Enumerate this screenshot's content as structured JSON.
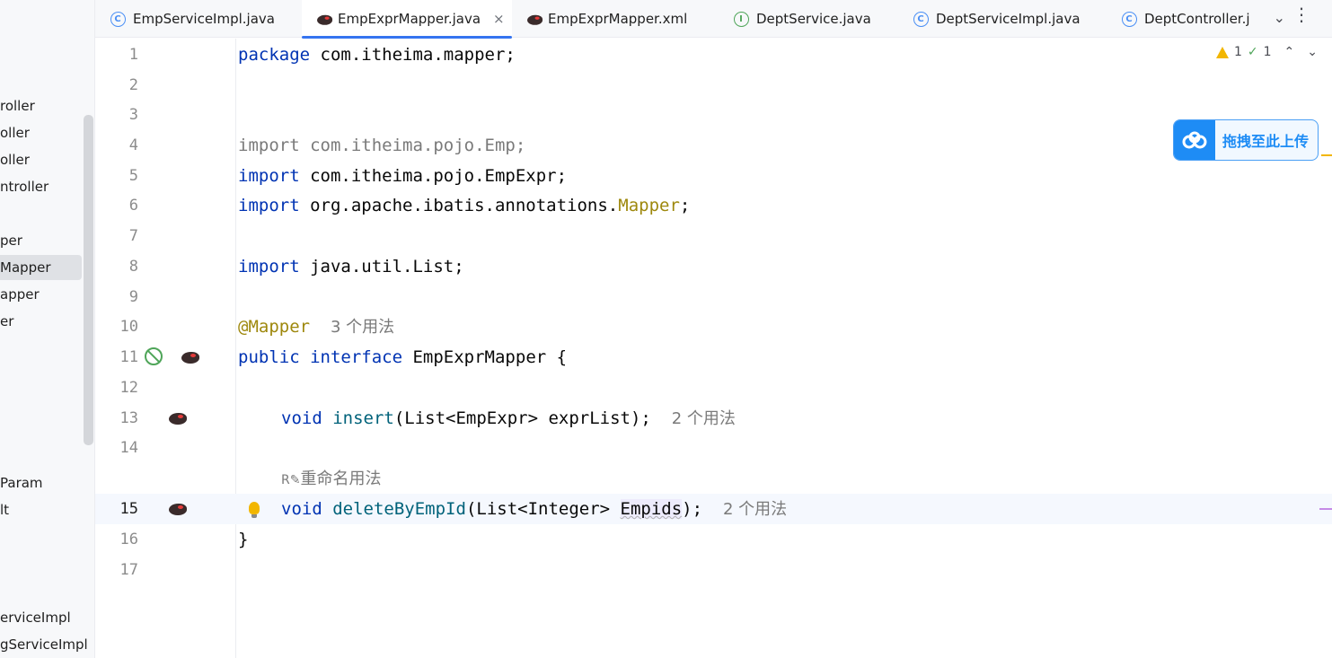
{
  "project_tree": {
    "items": [
      {
        "label": "roller",
        "selected": false
      },
      {
        "label": "oller",
        "selected": false
      },
      {
        "label": "oller",
        "selected": false
      },
      {
        "label": "ntroller",
        "selected": false
      },
      {
        "label": "per",
        "selected": false
      },
      {
        "label": "Mapper",
        "selected": true
      },
      {
        "label": "apper",
        "selected": false
      },
      {
        "label": "er",
        "selected": false
      },
      {
        "label": "Param",
        "selected": false
      },
      {
        "label": "lt",
        "selected": false
      },
      {
        "label": "erviceImpl",
        "selected": false
      },
      {
        "label": "gServiceImpl",
        "selected": false
      }
    ]
  },
  "tabs": [
    {
      "label": "EmpServiceImpl.java",
      "icon": "class-icon",
      "active": false
    },
    {
      "label": "EmpExprMapper.java",
      "icon": "mybatis-bird-icon",
      "active": true,
      "close": "×"
    },
    {
      "label": "EmpExprMapper.xml",
      "icon": "mybatis-bird-icon",
      "active": false
    },
    {
      "label": "DeptService.java",
      "icon": "interface-icon",
      "active": false
    },
    {
      "label": "DeptServiceImpl.java",
      "icon": "class-icon",
      "active": false
    },
    {
      "label": "DeptController.j",
      "icon": "class-icon",
      "active": false
    }
  ],
  "tab_bar": {
    "more": "⌄",
    "menu": "⋮"
  },
  "indicators": {
    "warnings": "1",
    "ok": "1",
    "up": "⌃",
    "down": "⌄"
  },
  "upload_widget": {
    "label": "拖拽至此上传",
    "icon": "cloud-icon"
  },
  "editor": {
    "current_line": 15,
    "lines": [
      {
        "n": "1"
      },
      {
        "n": "2"
      },
      {
        "n": "3"
      },
      {
        "n": "4"
      },
      {
        "n": "5"
      },
      {
        "n": "6"
      },
      {
        "n": "7"
      },
      {
        "n": "8"
      },
      {
        "n": "9"
      },
      {
        "n": "10"
      },
      {
        "n": "11"
      },
      {
        "n": "12"
      },
      {
        "n": "13"
      },
      {
        "n": "14"
      },
      {
        "n": "15"
      },
      {
        "n": "16"
      },
      {
        "n": "17"
      }
    ],
    "code": {
      "l1_kw": "package",
      "l1_rest": " com.itheima.mapper;",
      "l4_kw": "import",
      "l4_rest": " com.itheima.pojo.Emp;",
      "l5_kw": "import",
      "l5_rest": " com.itheima.pojo.EmpExpr;",
      "l6_kw": "import",
      "l6_rest": " org.apache.ibatis.annotations.",
      "l6_ann": "Mapper",
      "l6_end": ";",
      "l8_kw": "import",
      "l8_rest": " java.util.List;",
      "l10_ann": "@Mapper",
      "l10_hint": "3 个用法",
      "l11_kw1": "public",
      "l11_kw2": "interface",
      "l11_rest": " EmpExprMapper {",
      "l13_kw": "void",
      "l13_fn": "insert",
      "l13_rest": "(List<EmpExpr> exprList);",
      "l13_hint": "2 个用法",
      "inlay_rename": "重命名用法",
      "l15_kw": "void",
      "l15_fn": "deleteByEmpId",
      "l15_rest": "(List<Integer> ",
      "l15_param": "Empids",
      "l15_end": ");",
      "l15_hint": "2 个用法",
      "l16": "}"
    }
  },
  "colors": {
    "keyword": "#0033b3",
    "annotation": "#9e880d",
    "method": "#00627a",
    "accent": "#3574f0"
  }
}
